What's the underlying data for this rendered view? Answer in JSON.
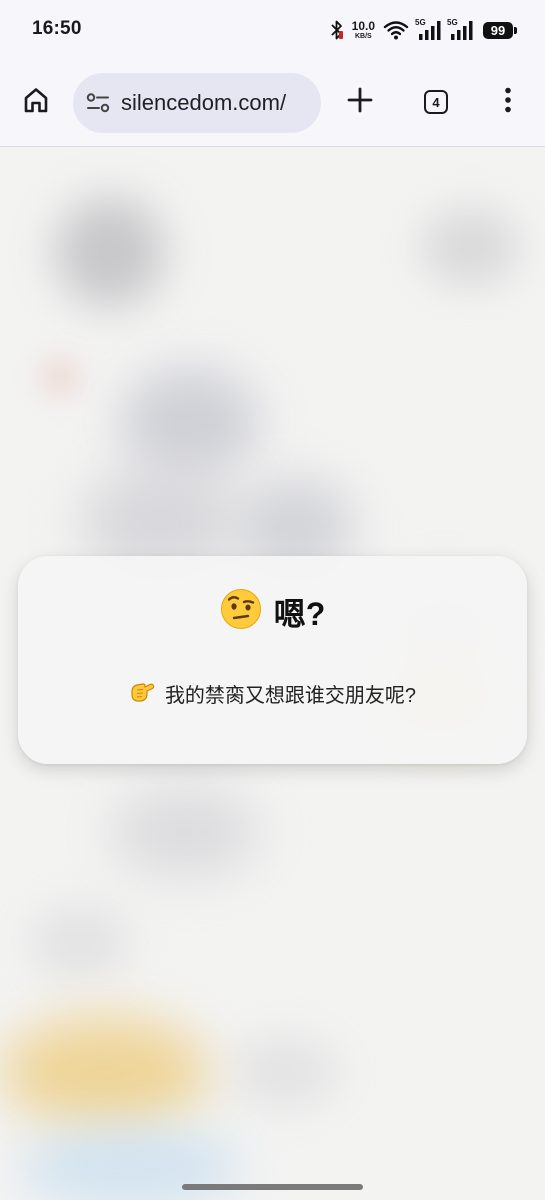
{
  "status_bar": {
    "time": "16:50",
    "net_speed": {
      "value": "10.0",
      "unit": "KB/S"
    },
    "signal_1_label": "5G",
    "signal_2_label": "5G",
    "battery_level": "99",
    "icons": [
      "bluetooth-icon",
      "wifi-icon",
      "signal-icon",
      "battery-icon"
    ]
  },
  "browser": {
    "url": "silencedom.com/",
    "tab_count": "4",
    "icons": [
      "home-icon",
      "site-settings-icon",
      "new-tab-icon",
      "tab-switcher-icon",
      "more-menu-icon"
    ]
  },
  "dialog": {
    "title_emoji": "face-with-raised-eyebrow-emoji",
    "title": "嗯?",
    "message_emoji": "pointing-hand-emoji",
    "message": "我的禁脔又想跟谁交朋友呢?"
  },
  "colors": {
    "chrome_bg": "#f7f6fb",
    "url_bar_bg": "#e6e6f2",
    "page_bg": "#f3f3f2",
    "dialog_bg": "#f5f5f5"
  }
}
